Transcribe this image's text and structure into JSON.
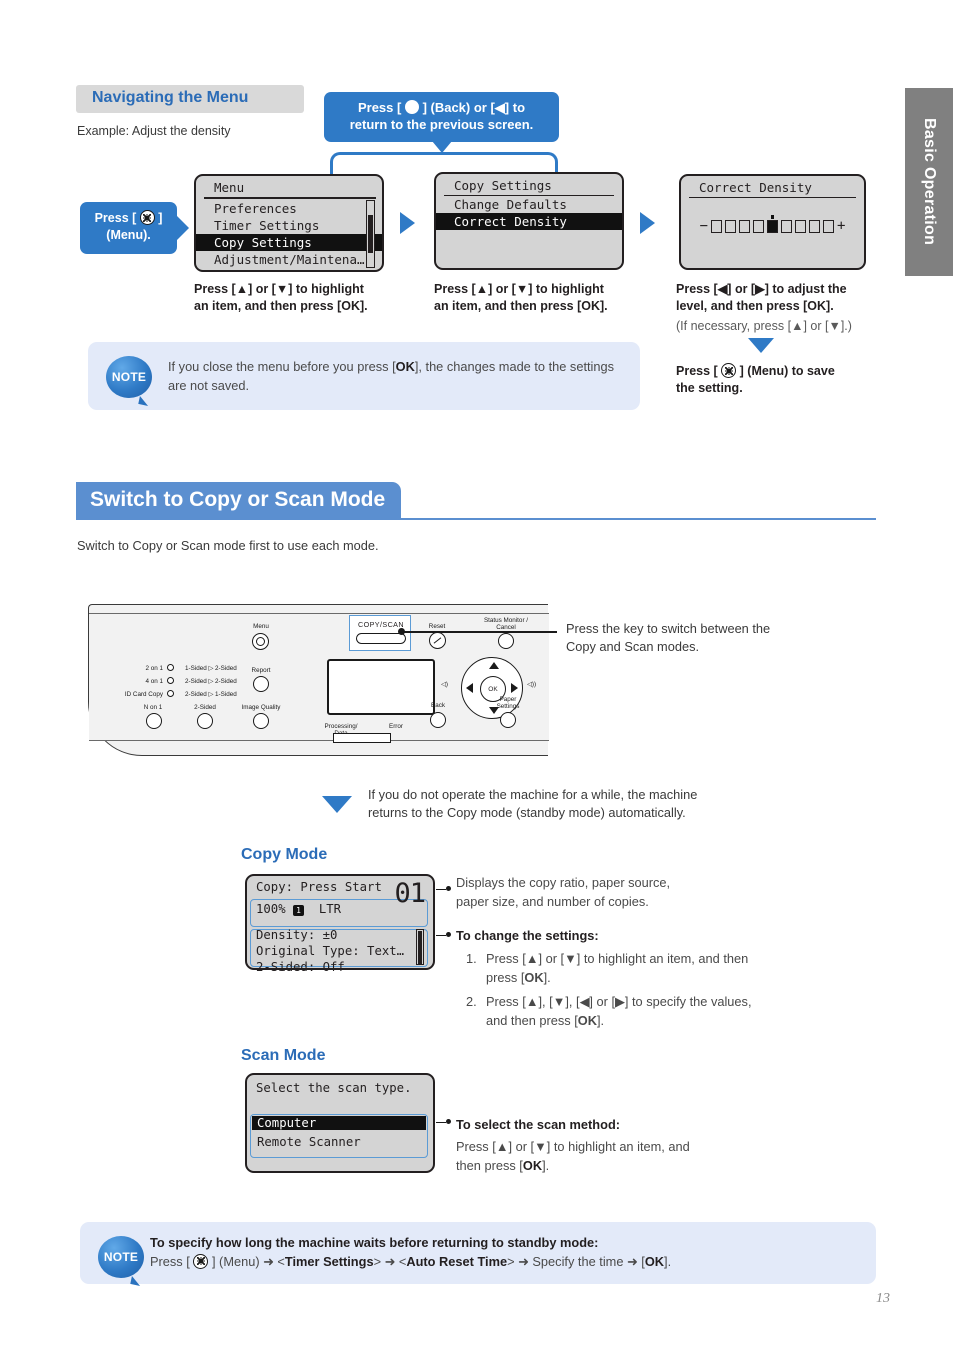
{
  "side_tab": {
    "label": "Basic Operation"
  },
  "nav_section": {
    "header": "Navigating the Menu",
    "subtitle": "Example: Adjust the density",
    "callout_back_line1": "Press [ ",
    "callout_back_line1b": " ] (Back) or [◀] to",
    "callout_back_line2": "return to the previous screen.",
    "callout_menu_line1a": "Press [ ",
    "callout_menu_line1b": " ]",
    "callout_menu_line2": "(Menu).",
    "screen1": {
      "title": "Menu",
      "rows": [
        "Preferences",
        "Timer Settings",
        "Copy Settings",
        "Adjustment/Maintena…"
      ],
      "selected_index": 2
    },
    "screen2": {
      "title": "Copy Settings",
      "rows": [
        "Change Defaults",
        "Correct Density"
      ],
      "selected_index": 1
    },
    "screen3": {
      "title": "Correct Density",
      "minus": "−",
      "plus": "+",
      "levels": 9,
      "current_level": 5
    },
    "caption1_line1": "Press [▲] or [▼] to highlight",
    "caption1_line2": "an item, and then press [OK].",
    "caption2_line1": "Press [▲] or [▼] to highlight",
    "caption2_line2": "an item, and then press [OK].",
    "caption3_line1": "Press [◀] or [▶] to adjust the",
    "caption3_line2": "level, and then press [OK].",
    "caption3_sub": "(If necessary, press [▲] or [▼].)",
    "caption4_line1a": "Press [ ",
    "caption4_line1b": " ] (Menu) to save",
    "caption4_line2": "the setting."
  },
  "note_top": {
    "badge": "NOTE",
    "text_a": "If you close the menu before you press [",
    "text_b": "OK",
    "text_c": "], the changes made to the settings are not saved."
  },
  "section": {
    "heading": "Switch to Copy or Scan Mode",
    "lead": "Switch to Copy or Scan mode first to use each mode."
  },
  "panel": {
    "copyscan_label": "COPY/SCAN",
    "menu_label": "Menu",
    "leds": [
      "2 on 1",
      "4 on 1",
      "ID Card Copy"
    ],
    "duplex": [
      "1-Sided ▷ 2-Sided",
      "2-Sided ▷ 2-Sided",
      "2-Sided ▷ 1-Sided"
    ],
    "buttons": {
      "n_on_1": "N on 1",
      "two_sided": "2-Sided",
      "report": "Report",
      "image_quality": "Image Quality",
      "reset": "Reset",
      "status_monitor": "Status Monitor /",
      "status_monitor2": "Cancel",
      "back": "Back",
      "paper_settings": "Paper",
      "paper_settings2": "Settings",
      "ok": "OK"
    },
    "leds_bottom": {
      "processing": "Processing/",
      "processing2": "Data",
      "error": "Error"
    },
    "callout_line1": "Press the key to switch between the",
    "callout_line2": "Copy and Scan modes."
  },
  "standby": {
    "line1": "If you do not operate the machine for a while, the machine",
    "line2": "returns to the Copy mode (standby mode) automatically."
  },
  "copy_mode": {
    "title": "Copy Mode",
    "screen": {
      "line1": "Copy: Press Start",
      "ratio": "100%",
      "source_badge": "1",
      "paper_size": "LTR",
      "count": "01",
      "row1": "Density: ±0",
      "row2": "Original Type: Text…",
      "row3": "2-Sided: Off"
    },
    "desc_line1": "Displays the copy ratio, paper source,",
    "desc_line2": "paper size, and number of copies.",
    "change_heading": "To change the settings:",
    "step1a": "Press [▲] or [▼] to highlight an item, and",
    "step1b": "then press [",
    "step1c": "OK",
    "step1d": "].",
    "step2a": "Press [▲], [▼], [◀] or [▶] to specify the",
    "step2b": "values, and then press [",
    "step2c": "OK",
    "step2d": "].",
    "num1": "1.",
    "num2": "2."
  },
  "scan_mode": {
    "title": "Scan Mode",
    "screen": {
      "line1": "Select the scan type.",
      "option1": "Computer",
      "option2": "Remote Scanner"
    },
    "select_heading": "To select the scan method:",
    "desc_line1": "Press [▲] or [▼] to highlight an item, and",
    "desc_line2a": "then press [",
    "desc_line2b": "OK",
    "desc_line2c": "]."
  },
  "note_bottom": {
    "badge": "NOTE",
    "heading": "To specify how long the machine waits before returning to standby mode:",
    "body_a": "Press [ ",
    "body_b": " ] (Menu) ➜ <",
    "body_c": "Timer Settings",
    "body_d": "> ➜ <",
    "body_e": "Auto Reset Time",
    "body_f": "> ➜ Specify the time ➜ [",
    "body_g": "OK",
    "body_h": "]."
  },
  "page_number": "13",
  "colors": {
    "accent_blue": "#2f7ac6",
    "heading_blue": "#5b8fd0",
    "title_blue": "#2b6cb7",
    "note_bg": "#e3eaf9",
    "lcd_bg": "#d4d4d4",
    "tab_gray": "#808080"
  }
}
